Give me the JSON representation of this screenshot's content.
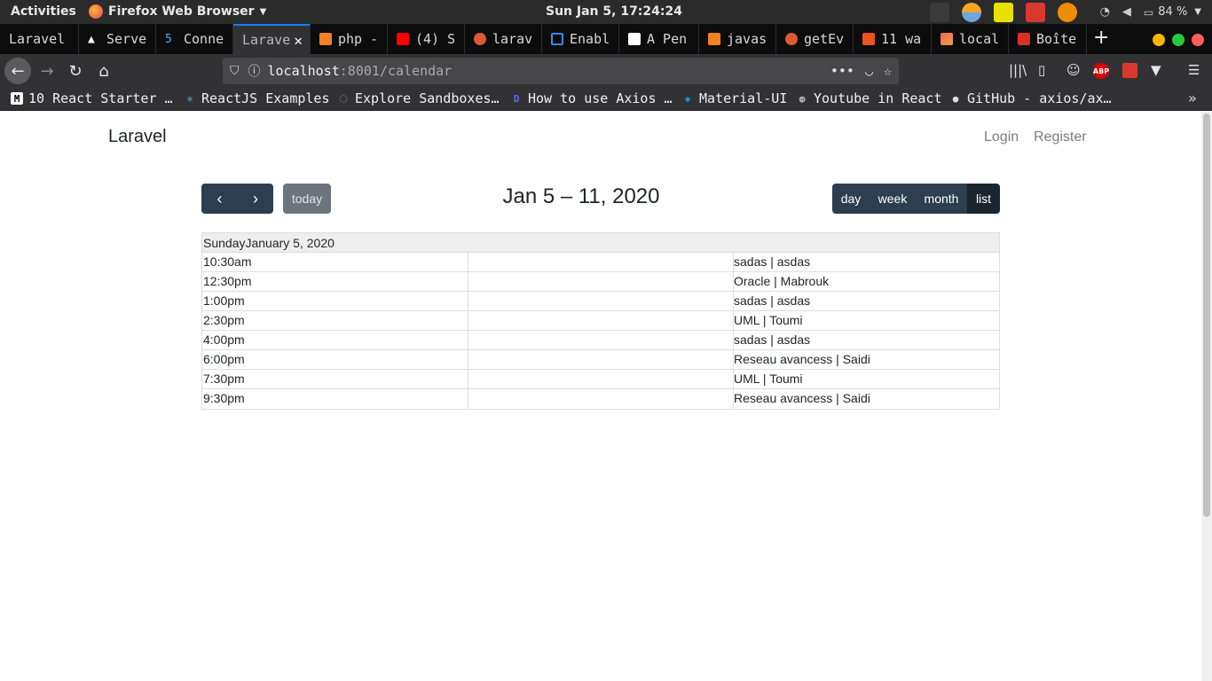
{
  "topbar": {
    "activities": "Activities",
    "app_name": "Firefox Web Browser",
    "clock": "Sun Jan  5, 17:24:24",
    "battery": "84 %"
  },
  "tabs": [
    {
      "label": "Laravel",
      "icon": "none"
    },
    {
      "label": "Serve",
      "icon": "warning-icon"
    },
    {
      "label": "Conne",
      "icon": "five-icon"
    },
    {
      "label": "Larave",
      "icon": "none",
      "active": true
    },
    {
      "label": "php -",
      "icon": "stackoverflow-icon"
    },
    {
      "label": "(4) S",
      "icon": "youtube-icon"
    },
    {
      "label": "larav",
      "icon": "duckduckgo-icon"
    },
    {
      "label": "Enabl",
      "icon": "window-icon"
    },
    {
      "label": "A Pen",
      "icon": "codepen-icon"
    },
    {
      "label": "javas",
      "icon": "stackoverflow-icon"
    },
    {
      "label": "getEv",
      "icon": "duckduckgo-icon"
    },
    {
      "label": "11 wa",
      "icon": "ubuntu-icon"
    },
    {
      "label": "local",
      "icon": "laravel-icon"
    },
    {
      "label": "Boîte",
      "icon": "gmail-icon"
    }
  ],
  "url": {
    "host": "localhost",
    "path": ":8001/calendar"
  },
  "bookmarks": [
    {
      "label": "10 React Starter …",
      "icon": "medium-icon"
    },
    {
      "label": "ReactJS Examples",
      "icon": "react-icon"
    },
    {
      "label": "Explore Sandboxes…",
      "icon": "codesandbox-icon"
    },
    {
      "label": "How to use Axios …",
      "icon": "dev-icon"
    },
    {
      "label": "Material-UI",
      "icon": "material-ui-icon"
    },
    {
      "label": "Youtube in React",
      "icon": "globe-icon"
    },
    {
      "label": "GitHub - axios/ax…",
      "icon": "github-icon"
    }
  ],
  "site": {
    "brand": "Laravel",
    "login": "Login",
    "register": "Register"
  },
  "calendar": {
    "title": "Jan 5 – 11, 2020",
    "today_label": "today",
    "views": [
      "day",
      "week",
      "month",
      "list"
    ],
    "active_view": "list",
    "day_header": "SundayJanuary 5, 2020",
    "events": [
      {
        "time": "10:30am",
        "title": "sadas | asdas"
      },
      {
        "time": "12:30pm",
        "title": "Oracle | Mabrouk"
      },
      {
        "time": "1:00pm",
        "title": "sadas | asdas"
      },
      {
        "time": "2:30pm",
        "title": "UML | Toumi"
      },
      {
        "time": "4:00pm",
        "title": "sadas | asdas"
      },
      {
        "time": "6:00pm",
        "title": "Reseau avancess | Saidi"
      },
      {
        "time": "7:30pm",
        "title": "UML | Toumi"
      },
      {
        "time": "9:30pm",
        "title": "Reseau avancess | Saidi"
      }
    ]
  },
  "colors": {
    "button_bg": "#2c3e50",
    "button_active_bg": "#1a252f",
    "today_disabled_bg": "#6c757d",
    "tab_accent": "#0a84ff"
  }
}
